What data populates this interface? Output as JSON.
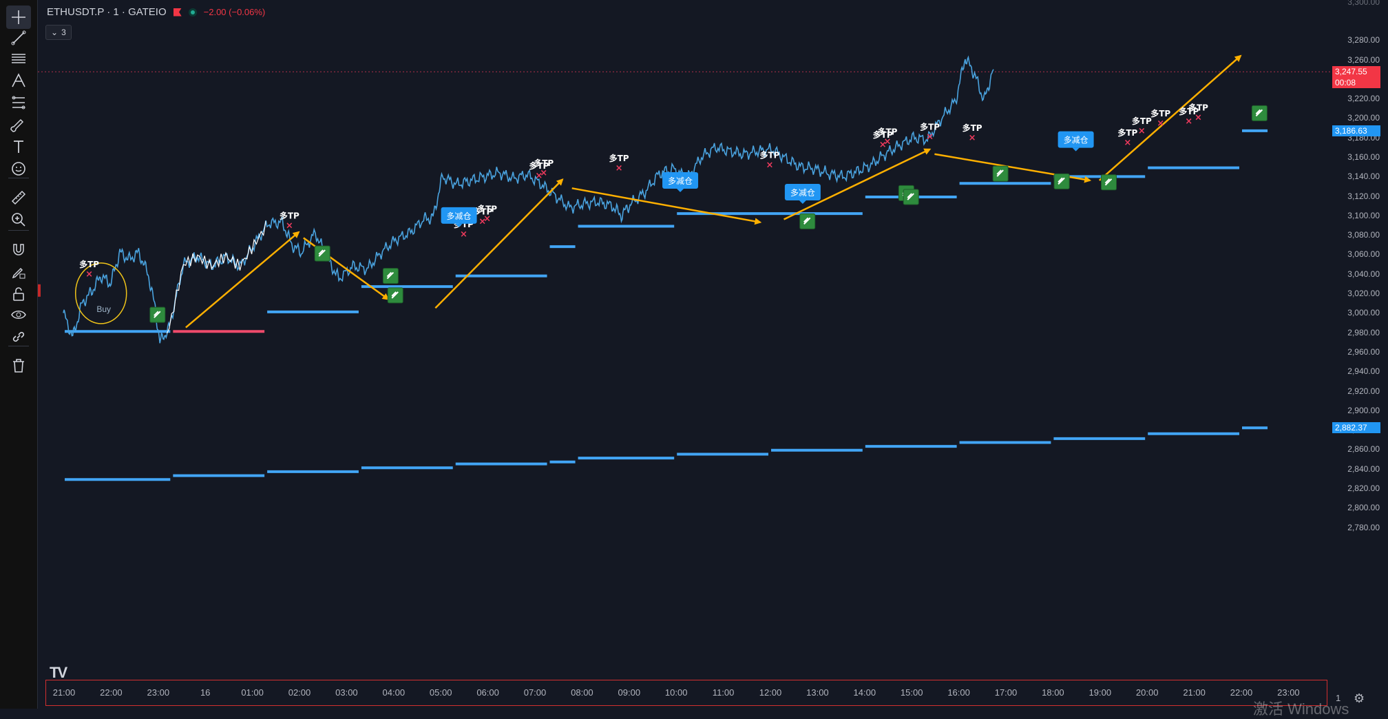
{
  "header": {
    "symbol": "ETHUSDT.P · 1 · GATEIO",
    "change": "−2.00 (−0.06%)",
    "collapse_count": "3"
  },
  "toolbar": {
    "tools": [
      {
        "name": "crosshair-tool",
        "icon": "crosshair-icon"
      },
      {
        "name": "trend-line-tool",
        "icon": "trend-line-icon"
      },
      {
        "name": "horizontal-lines-tool",
        "icon": "horizontal-lines-icon"
      },
      {
        "name": "pitchfork-tool",
        "icon": "pitchfork-icon"
      },
      {
        "name": "fib-tool",
        "icon": "fib-retracement-icon"
      },
      {
        "name": "brush-tool",
        "icon": "brush-icon"
      },
      {
        "name": "text-tool",
        "icon": "text-icon"
      },
      {
        "name": "emoji-tool",
        "icon": "emoji-icon"
      },
      {
        "name": "measure-tool",
        "icon": "ruler-icon"
      },
      {
        "name": "zoom-tool",
        "icon": "zoom-in-icon"
      },
      {
        "name": "magnet-tool",
        "icon": "magnet-icon"
      },
      {
        "name": "stay-drawing-tool",
        "icon": "pencil-lock-icon"
      },
      {
        "name": "lock-tool",
        "icon": "lock-icon"
      },
      {
        "name": "hide-tool",
        "icon": "eye-icon"
      },
      {
        "name": "link-tool",
        "icon": "link-icon"
      },
      {
        "name": "remove-tool",
        "icon": "trash-icon"
      }
    ]
  },
  "colors": {
    "background": "#141823",
    "candle_up": "#ffffff",
    "candle_line": "#4aa3df",
    "level_line": "#42a5f5",
    "level_line_red": "#ef4a6b",
    "arrow": "#ffb000",
    "tp_marker": "#ef3a5d",
    "fill_marker": "#2e8b3d",
    "last_price_tag": "#f23645",
    "level_tag": "#2196f3"
  },
  "price_axis": {
    "labels": [
      "3,280.00",
      "3,260.00",
      "3,240.00",
      "3,220.00",
      "3,200.00",
      "3,180.00",
      "3,160.00",
      "3,140.00",
      "3,120.00",
      "3,100.00",
      "3,080.00",
      "3,060.00",
      "3,040.00",
      "3,020.00",
      "3,000.00",
      "2,980.00",
      "2,960.00",
      "2,940.00",
      "2,920.00",
      "2,900.00",
      "2,880.00",
      "2,860.00",
      "2,840.00",
      "2,820.00",
      "2,800.00",
      "2,780.00"
    ],
    "top_partial": "3,300.00",
    "last_price": "3,247.55",
    "countdown": "00:08",
    "level_upper": "3,186.63",
    "level_lower": "2,882.37"
  },
  "time_axis": {
    "labels": [
      "21:00",
      "22:00",
      "23:00",
      "16",
      "01:00",
      "02:00",
      "03:00",
      "04:00",
      "05:00",
      "06:00",
      "07:00",
      "08:00",
      "09:00",
      "10:00",
      "11:00",
      "12:00",
      "13:00",
      "14:00",
      "15:00",
      "16:00",
      "17:00",
      "18:00",
      "19:00",
      "20:00",
      "21:00",
      "22:00",
      "23:00"
    ],
    "trailing": "1"
  },
  "chart_data": {
    "type": "line",
    "title": "",
    "xlabel": "",
    "ylabel": "",
    "ylim": [
      2770,
      3305
    ],
    "price_path": [
      {
        "t": 0.0,
        "p": 3000
      },
      {
        "t": 0.2,
        "p": 2975
      },
      {
        "t": 0.4,
        "p": 3010
      },
      {
        "t": 0.6,
        "p": 3022
      },
      {
        "t": 0.8,
        "p": 3038
      },
      {
        "t": 1.0,
        "p": 3030
      },
      {
        "t": 1.2,
        "p": 3062
      },
      {
        "t": 1.4,
        "p": 3055
      },
      {
        "t": 1.6,
        "p": 3062
      },
      {
        "t": 1.8,
        "p": 3040
      },
      {
        "t": 1.95,
        "p": 3005
      },
      {
        "t": 2.05,
        "p": 2970
      },
      {
        "t": 2.25,
        "p": 2985
      },
      {
        "t": 2.55,
        "p": 3050
      },
      {
        "t": 2.85,
        "p": 3058
      },
      {
        "t": 3.15,
        "p": 3048
      },
      {
        "t": 3.45,
        "p": 3058
      },
      {
        "t": 3.75,
        "p": 3048
      },
      {
        "t": 4.05,
        "p": 3070
      },
      {
        "t": 4.35,
        "p": 3092
      },
      {
        "t": 4.65,
        "p": 3093
      },
      {
        "t": 4.85,
        "p": 3070
      },
      {
        "t": 5.05,
        "p": 3062
      },
      {
        "t": 5.35,
        "p": 3082
      },
      {
        "t": 5.65,
        "p": 3052
      },
      {
        "t": 5.85,
        "p": 3035
      },
      {
        "t": 6.15,
        "p": 3048
      },
      {
        "t": 6.45,
        "p": 3045
      },
      {
        "t": 6.75,
        "p": 3062
      },
      {
        "t": 7.05,
        "p": 3075
      },
      {
        "t": 7.35,
        "p": 3082
      },
      {
        "t": 7.65,
        "p": 3096
      },
      {
        "t": 7.85,
        "p": 3098
      },
      {
        "t": 8.05,
        "p": 3140
      },
      {
        "t": 8.35,
        "p": 3132
      },
      {
        "t": 8.65,
        "p": 3136
      },
      {
        "t": 8.95,
        "p": 3140
      },
      {
        "t": 9.25,
        "p": 3144
      },
      {
        "t": 9.55,
        "p": 3138
      },
      {
        "t": 9.85,
        "p": 3142
      },
      {
        "t": 10.15,
        "p": 3132
      },
      {
        "t": 10.45,
        "p": 3120
      },
      {
        "t": 10.75,
        "p": 3108
      },
      {
        "t": 11.05,
        "p": 3112
      },
      {
        "t": 11.35,
        "p": 3114
      },
      {
        "t": 11.65,
        "p": 3110
      },
      {
        "t": 11.85,
        "p": 3100
      },
      {
        "t": 12.05,
        "p": 3112
      },
      {
        "t": 12.35,
        "p": 3124
      },
      {
        "t": 12.65,
        "p": 3143
      },
      {
        "t": 12.95,
        "p": 3148
      },
      {
        "t": 13.25,
        "p": 3138
      },
      {
        "t": 13.55,
        "p": 3160
      },
      {
        "t": 13.85,
        "p": 3170
      },
      {
        "t": 14.15,
        "p": 3166
      },
      {
        "t": 14.45,
        "p": 3163
      },
      {
        "t": 14.75,
        "p": 3166
      },
      {
        "t": 15.05,
        "p": 3168
      },
      {
        "t": 15.35,
        "p": 3158
      },
      {
        "t": 15.65,
        "p": 3150
      },
      {
        "t": 15.95,
        "p": 3148
      },
      {
        "t": 16.25,
        "p": 3143
      },
      {
        "t": 16.55,
        "p": 3140
      },
      {
        "t": 16.85,
        "p": 3145
      },
      {
        "t": 17.15,
        "p": 3152
      },
      {
        "t": 17.45,
        "p": 3163
      },
      {
        "t": 17.75,
        "p": 3172
      },
      {
        "t": 18.05,
        "p": 3180
      },
      {
        "t": 18.35,
        "p": 3178
      },
      {
        "t": 18.65,
        "p": 3200
      },
      {
        "t": 18.95,
        "p": 3218
      },
      {
        "t": 19.15,
        "p": 3262
      },
      {
        "t": 19.35,
        "p": 3245
      },
      {
        "t": 19.55,
        "p": 3218
      },
      {
        "t": 19.75,
        "p": 3250
      }
    ],
    "levels_upper": [
      {
        "t0": 0.0,
        "t1": 2.3,
        "p": 2981
      },
      {
        "t0": 2.3,
        "t1": 4.3,
        "p": 2981,
        "color": "red"
      },
      {
        "t0": 4.3,
        "t1": 6.3,
        "p": 3001
      },
      {
        "t0": 6.3,
        "t1": 8.3,
        "p": 3027
      },
      {
        "t0": 8.3,
        "t1": 10.3,
        "p": 3038
      },
      {
        "t0": 10.3,
        "t1": 10.9,
        "p": 3068
      },
      {
        "t0": 10.9,
        "t1": 13.0,
        "p": 3089
      },
      {
        "t0": 13.0,
        "t1": 17.0,
        "p": 3102
      },
      {
        "t0": 17.0,
        "t1": 19.0,
        "p": 3119
      },
      {
        "t0": 19.0,
        "t1": 21.0,
        "p": 3133
      },
      {
        "t0": 21.0,
        "t1": 23.0,
        "p": 3140
      },
      {
        "t0": 23.0,
        "t1": 25.0,
        "p": 3149
      },
      {
        "t0": 25.0,
        "t1": 25.6,
        "p": 3187
      }
    ],
    "levels_lower": [
      {
        "t0": 0.0,
        "t1": 2.3,
        "p": 2829
      },
      {
        "t0": 2.3,
        "t1": 4.3,
        "p": 2833
      },
      {
        "t0": 4.3,
        "t1": 6.3,
        "p": 2837
      },
      {
        "t0": 6.3,
        "t1": 8.3,
        "p": 2841
      },
      {
        "t0": 8.3,
        "t1": 10.3,
        "p": 2845
      },
      {
        "t0": 10.3,
        "t1": 10.9,
        "p": 2847
      },
      {
        "t0": 10.9,
        "t1": 13.0,
        "p": 2851
      },
      {
        "t0": 13.0,
        "t1": 15.0,
        "p": 2855
      },
      {
        "t0": 15.0,
        "t1": 17.0,
        "p": 2859
      },
      {
        "t0": 17.0,
        "t1": 19.0,
        "p": 2863
      },
      {
        "t0": 19.0,
        "t1": 21.0,
        "p": 2867
      },
      {
        "t0": 21.0,
        "t1": 23.0,
        "p": 2871
      },
      {
        "t0": 23.0,
        "t1": 25.0,
        "p": 2876
      },
      {
        "t0": 25.0,
        "t1": 25.6,
        "p": 2882
      }
    ],
    "arrows": [
      {
        "t0": 2.6,
        "p0": 2985,
        "t1": 5.0,
        "p1": 3083
      },
      {
        "t0": 5.1,
        "p0": 3077,
        "t1": 6.9,
        "p1": 3014
      },
      {
        "t0": 7.9,
        "p0": 3005,
        "t1": 10.6,
        "p1": 3137
      },
      {
        "t0": 10.8,
        "p0": 3128,
        "t1": 14.8,
        "p1": 3093
      },
      {
        "t0": 15.3,
        "p0": 3096,
        "t1": 18.4,
        "p1": 3168
      },
      {
        "t0": 18.5,
        "p0": 3163,
        "t1": 21.8,
        "p1": 3136
      },
      {
        "t0": 22.0,
        "p0": 3136,
        "t1": 25.0,
        "p1": 3264
      }
    ],
    "tp_markers": [
      {
        "t": 0.55,
        "p": 3037,
        "label": "多TP"
      },
      {
        "t": 4.8,
        "p": 3087,
        "label": "多TP"
      },
      {
        "t": 8.5,
        "p": 3078,
        "label": "多TP"
      },
      {
        "t": 8.9,
        "p": 3091,
        "label": "多TP"
      },
      {
        "t": 9.0,
        "p": 3094,
        "label": "多TP"
      },
      {
        "t": 10.1,
        "p": 3138,
        "label": "多TP"
      },
      {
        "t": 10.2,
        "p": 3141,
        "label": "多TP"
      },
      {
        "t": 11.8,
        "p": 3146,
        "label": "多TP"
      },
      {
        "t": 15.0,
        "p": 3149,
        "label": "多TP"
      },
      {
        "t": 17.4,
        "p": 3170,
        "label": "多TP"
      },
      {
        "t": 17.5,
        "p": 3173,
        "label": "多TP"
      },
      {
        "t": 18.4,
        "p": 3178,
        "label": "多TP"
      },
      {
        "t": 19.3,
        "p": 3177,
        "label": "多TP"
      },
      {
        "t": 22.6,
        "p": 3172,
        "label": "多TP"
      },
      {
        "t": 22.9,
        "p": 3184,
        "label": "多TP"
      },
      {
        "t": 23.3,
        "p": 3192,
        "label": "多TP"
      },
      {
        "t": 23.9,
        "p": 3194,
        "label": "多TP"
      },
      {
        "t": 24.1,
        "p": 3198,
        "label": "多TP"
      }
    ],
    "add_tags": [
      {
        "t": 8.4,
        "p": 3100,
        "label": "多减仓"
      },
      {
        "t": 13.1,
        "p": 3136,
        "label": "多减仓"
      },
      {
        "t": 15.7,
        "p": 3124,
        "label": "多减仓"
      },
      {
        "t": 21.5,
        "p": 3178,
        "label": "多减仓"
      }
    ],
    "fill_markers": [
      {
        "t": 2.0,
        "p": 2998
      },
      {
        "t": 5.5,
        "p": 3061
      },
      {
        "t": 6.95,
        "p": 3038
      },
      {
        "t": 7.05,
        "p": 3018
      },
      {
        "t": 15.8,
        "p": 3094
      },
      {
        "t": 17.9,
        "p": 3123
      },
      {
        "t": 18.0,
        "p": 3119
      },
      {
        "t": 19.9,
        "p": 3143
      },
      {
        "t": 21.2,
        "p": 3135
      },
      {
        "t": 22.2,
        "p": 3134
      },
      {
        "t": 25.4,
        "p": 3205
      }
    ],
    "buy_annotation": {
      "t": 0.8,
      "p": 3018,
      "label": "Buy"
    }
  }
}
